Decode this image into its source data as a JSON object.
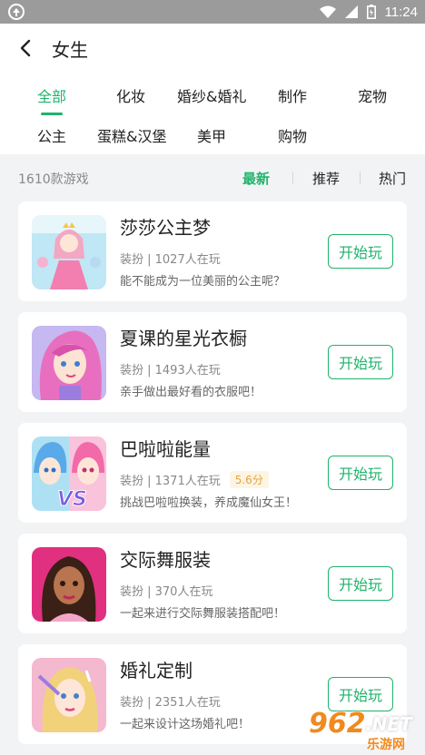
{
  "status_bar": {
    "time": "11:24"
  },
  "header": {
    "title": "女生"
  },
  "categories": [
    {
      "label": "全部",
      "active": true
    },
    {
      "label": "化妆"
    },
    {
      "label": "婚纱&婚礼"
    },
    {
      "label": "制作"
    },
    {
      "label": "宠物"
    },
    {
      "label": "公主"
    },
    {
      "label": "蛋糕&汉堡"
    },
    {
      "label": "美甲"
    },
    {
      "label": "购物"
    }
  ],
  "list": {
    "count_label": "1610款游戏",
    "sort_options": [
      {
        "label": "最新",
        "active": true
      },
      {
        "label": "推荐"
      },
      {
        "label": "热门"
      }
    ]
  },
  "games": [
    {
      "name": "莎莎公主梦",
      "meta": "装扮 | 1027人在玩",
      "desc": "能不能成为一位美丽的公主呢？",
      "action": "开始玩"
    },
    {
      "name": "夏课的星光衣橱",
      "meta": "装扮 | 1493人在玩",
      "desc": "亲手做出最好看的衣服吧！",
      "action": "开始玩"
    },
    {
      "name": "巴啦啦能量",
      "meta": "装扮 | 1371人在玩",
      "rating": "5.6分",
      "desc": "挑战巴啦啦换装，养成魔仙女王！",
      "action": "开始玩"
    },
    {
      "name": "交际舞服装",
      "meta": "装扮 | 370人在玩",
      "desc": "一起来进行交际舞服装搭配吧！",
      "action": "开始玩"
    },
    {
      "name": "婚礼定制",
      "meta": "装扮 | 2351人在玩",
      "desc": "一起来设计这场婚礼吧！",
      "action": "开始玩"
    }
  ],
  "watermark": {
    "num": "962",
    "net": ".NET",
    "sub": "乐游网"
  },
  "colors": {
    "accent": "#1fb36b",
    "status_bar": "#9b9b9b",
    "background": "#f2f3f5",
    "rating_text": "#e8a33d"
  }
}
